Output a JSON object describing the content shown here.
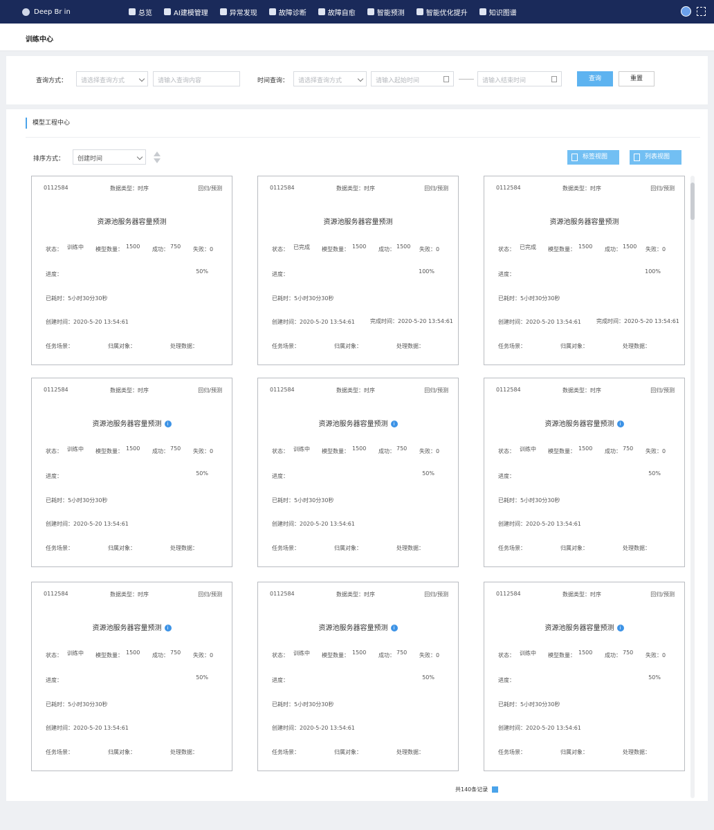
{
  "nav": {
    "brand": "Deep Br   in",
    "items": [
      {
        "label": "总览",
        "icon": "binoculars-icon"
      },
      {
        "label": "AI建模管理",
        "icon": "ai-icon"
      },
      {
        "label": "异常发现",
        "icon": "location-icon"
      },
      {
        "label": "故障诊断",
        "icon": "layers-icon"
      },
      {
        "label": "故障自愈",
        "icon": "sliders-icon"
      },
      {
        "label": "智能预测",
        "icon": "lock-icon"
      },
      {
        "label": "智能优化提升",
        "icon": "gear-icon"
      },
      {
        "label": "知识图谱",
        "icon": "bot-icon"
      }
    ]
  },
  "page": {
    "title": "训练中心"
  },
  "filter": {
    "query_label": "查询方式：",
    "query_select_placeholder": "请选择查询方式",
    "query_input_placeholder": "请输入查询内容",
    "time_label": "时间查询：",
    "time_select_placeholder": "请选择查询方式",
    "start_placeholder": "请输入起始时间",
    "end_placeholder": "请输入结束时间",
    "search_btn": "查询",
    "reset_btn": "重置"
  },
  "section": {
    "title": "模型工程中心"
  },
  "sort": {
    "label": "排序方式：",
    "value": "创建时间"
  },
  "views": {
    "tag_view": "标签视图",
    "list_view": "列表视图"
  },
  "cards": [
    {
      "id": "0112584",
      "type_label": "数据类型：时序",
      "tag": "回归/预测",
      "title": "资源池服务器容量预测",
      "info": false,
      "status_label": "状态：",
      "status": "训练中",
      "status_kind": "run",
      "model_count_label": "模型数量：",
      "model_count": "1500",
      "success_label": "成功：",
      "success": "750",
      "fail": "失败：0",
      "progress_label": "进度：",
      "progress": "50%",
      "elapsed": "已耗时：5小时30分30秒",
      "created": "创建时间：2020-5-20 13:54:61",
      "finished": "",
      "scene": "任务场景：",
      "object": "归属对象：",
      "data": "处理数据："
    },
    {
      "id": "0112584",
      "type_label": "数据类型：时序",
      "tag": "回归/预测",
      "title": "资源池服务器容量预测",
      "info": false,
      "status_label": "状态：",
      "status": "已完成",
      "status_kind": "done",
      "model_count_label": "模型数量：",
      "model_count": "1500",
      "success_label": "成功：",
      "success": "1500",
      "fail": "失败：0",
      "progress_label": "进度：",
      "progress": "100%",
      "elapsed": "已耗时：5小时30分30秒",
      "created": "创建时间：2020-5-20 13:54:61",
      "finished": "完成时间：2020-5-20 13:54:61",
      "scene": "任务场景：",
      "object": "归属对象：",
      "data": "处理数据："
    },
    {
      "id": "0112584",
      "type_label": "数据类型：时序",
      "tag": "回归/预测",
      "title": "资源池服务器容量预测",
      "info": false,
      "status_label": "状态：",
      "status": "已完成",
      "status_kind": "done",
      "model_count_label": "模型数量：",
      "model_count": "1500",
      "success_label": "成功：",
      "success": "1500",
      "fail": "失败：0",
      "progress_label": "进度：",
      "progress": "100%",
      "elapsed": "已耗时：5小时30分30秒",
      "created": "创建时间：2020-5-20 13:54:61",
      "finished": "完成时间：2020-5-20 13:54:61",
      "scene": "任务场景：",
      "object": "归属对象：",
      "data": "处理数据："
    },
    {
      "id": "0112584",
      "type_label": "数据类型：时序",
      "tag": "回归/预测",
      "title": "资源池服务器容量预测",
      "info": true,
      "status_label": "状态：",
      "status": "训练中",
      "status_kind": "run",
      "model_count_label": "模型数量：",
      "model_count": "1500",
      "success_label": "成功：",
      "success": "750",
      "fail": "失败：0",
      "progress_label": "进度：",
      "progress": "50%",
      "elapsed": "已耗时：5小时30分30秒",
      "created": "创建时间：2020-5-20 13:54:61",
      "finished": "",
      "scene": "任务场景：",
      "object": "归属对象：",
      "data": "处理数据："
    },
    {
      "id": "0112584",
      "type_label": "数据类型：时序",
      "tag": "回归/预测",
      "title": "资源池服务器容量预测",
      "info": true,
      "status_label": "状态：",
      "status": "训练中",
      "status_kind": "run",
      "model_count_label": "模型数量：",
      "model_count": "1500",
      "success_label": "成功：",
      "success": "750",
      "fail": "失败：0",
      "progress_label": "进度：",
      "progress": "50%",
      "elapsed": "已耗时：5小时30分30秒",
      "created": "创建时间：2020-5-20 13:54:61",
      "finished": "",
      "scene": "任务场景：",
      "object": "归属对象：",
      "data": "处理数据："
    },
    {
      "id": "0112584",
      "type_label": "数据类型：时序",
      "tag": "回归/预测",
      "title": "资源池服务器容量预测",
      "info": true,
      "status_label": "状态：",
      "status": "训练中",
      "status_kind": "run",
      "model_count_label": "模型数量：",
      "model_count": "1500",
      "success_label": "成功：",
      "success": "750",
      "fail": "失败：0",
      "progress_label": "进度：",
      "progress": "50%",
      "elapsed": "已耗时：5小时30分30秒",
      "created": "创建时间：2020-5-20 13:54:61",
      "finished": "",
      "scene": "任务场景：",
      "object": "归属对象：",
      "data": "处理数据："
    },
    {
      "id": "0112584",
      "type_label": "数据类型：时序",
      "tag": "回归/预测",
      "title": "资源池服务器容量预测",
      "info": true,
      "status_label": "状态：",
      "status": "训练中",
      "status_kind": "run",
      "model_count_label": "模型数量：",
      "model_count": "1500",
      "success_label": "成功：",
      "success": "750",
      "fail": "失败：0",
      "progress_label": "进度：",
      "progress": "50%",
      "elapsed": "已耗时：5小时30分30秒",
      "created": "创建时间：2020-5-20 13:54:61",
      "finished": "",
      "scene": "任务场景：",
      "object": "归属对象：",
      "data": "处理数据："
    },
    {
      "id": "0112584",
      "type_label": "数据类型：时序",
      "tag": "回归/预测",
      "title": "资源池服务器容量预测",
      "info": true,
      "status_label": "状态：",
      "status": "训练中",
      "status_kind": "run",
      "model_count_label": "模型数量：",
      "model_count": "1500",
      "success_label": "成功：",
      "success": "750",
      "fail": "失败：0",
      "progress_label": "进度：",
      "progress": "50%",
      "elapsed": "已耗时：5小时30分30秒",
      "created": "创建时间：2020-5-20 13:54:61",
      "finished": "",
      "scene": "任务场景：",
      "object": "归属对象：",
      "data": "处理数据："
    },
    {
      "id": "0112584",
      "type_label": "数据类型：时序",
      "tag": "回归/预测",
      "title": "资源池服务器容量预测",
      "info": true,
      "status_label": "状态：",
      "status": "训练中",
      "status_kind": "run",
      "model_count_label": "模型数量：",
      "model_count": "1500",
      "success_label": "成功：",
      "success": "750",
      "fail": "失败：0",
      "progress_label": "进度：",
      "progress": "50%",
      "elapsed": "已耗时：5小时30分30秒",
      "created": "创建时间：2020-5-20 13:54:61",
      "finished": "",
      "scene": "任务场景：",
      "object": "归属对象：",
      "data": "处理数据："
    }
  ],
  "pagination": {
    "total": "共140条记录"
  }
}
